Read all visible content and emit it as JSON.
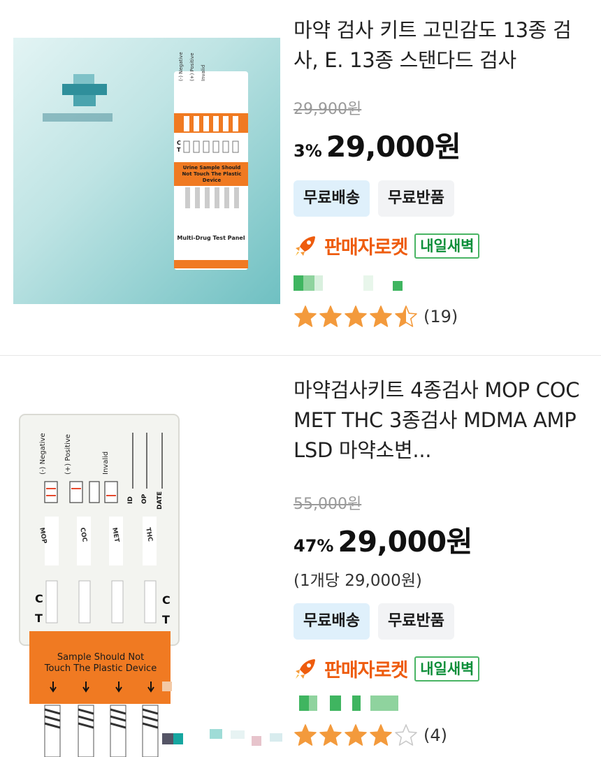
{
  "products": [
    {
      "title": "마약 검사 키트 고민감도 13종 검사, E. 13종 스탠다드 검사",
      "original_price": "29,900원",
      "discount": "3%",
      "price": "29,000원",
      "unit_price": "",
      "badges": [
        "무료배송",
        "무료반품"
      ],
      "rocket_label": "판매자로켓",
      "delivery_tag": "내일새벽",
      "rating": 4.5,
      "review_count": "(19)",
      "image": {
        "panel_label": "Multi-Drug Test Panel",
        "warning": "Urine Sample Should Not Touch The Plastic Device",
        "header_labels": [
          "(-) Negative",
          "(+) Positive",
          "Invalid"
        ],
        "marks": [
          "C",
          "T"
        ]
      }
    },
    {
      "title": "마약검사키트 4종검사 MOP COC MET THC 3종검사 MDMA AMP LSD 마약소변...",
      "original_price": "55,000원",
      "discount": "47%",
      "price": "29,000원",
      "unit_price": "(1개당 29,000원)",
      "badges": [
        "무료배송",
        "무료반품"
      ],
      "rocket_label": "판매자로켓",
      "delivery_tag": "내일새벽",
      "rating": 4.0,
      "review_count": "(4)",
      "image": {
        "warning": "Sample Should Not Touch The Plastic Device",
        "header_labels": [
          "(-) Negative",
          "(+) Positive",
          "Invalid"
        ],
        "field_labels": [
          "ID",
          "OP",
          "DATE"
        ],
        "strip_labels": [
          "MOP",
          "COC",
          "MET",
          "THC"
        ],
        "marks": [
          "C",
          "T"
        ]
      }
    }
  ],
  "colors": {
    "accent_orange": "#ee5c0e",
    "badge_blue": "#dff0fb",
    "badge_grey": "#f2f3f5",
    "dawn_green": "#0d8f3a",
    "star": "#f39a3c"
  }
}
